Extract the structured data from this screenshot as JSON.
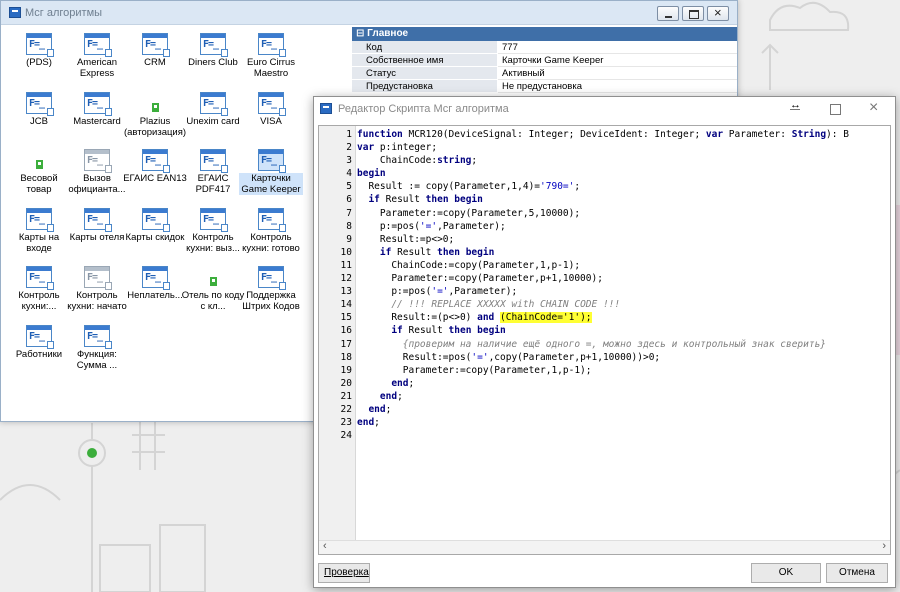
{
  "back_window": {
    "title": "Мсг алгоритмы",
    "icons": [
      {
        "label": "(PDS)",
        "kind": "doc"
      },
      {
        "label": "American Express",
        "kind": "doc"
      },
      {
        "label": "CRM",
        "kind": "doc"
      },
      {
        "label": "Diners Club",
        "kind": "doc"
      },
      {
        "label": "Euro Cirrus Maestro",
        "kind": "doc"
      },
      {
        "label": "JCB",
        "kind": "doc"
      },
      {
        "label": "Mastercard",
        "kind": "doc"
      },
      {
        "label": "Plazius (авторизация)",
        "kind": "green"
      },
      {
        "label": "Unexim card",
        "kind": "doc"
      },
      {
        "label": "VISA",
        "kind": "doc"
      },
      {
        "label": "Весовой товар",
        "kind": "green"
      },
      {
        "label": "Вызов официанта...",
        "kind": "doc-gray"
      },
      {
        "label": "ЕГАИС EAN13",
        "kind": "doc"
      },
      {
        "label": "ЕГАИС PDF417",
        "kind": "doc"
      },
      {
        "label": "Карточки Game Keeper",
        "kind": "doc-selected"
      },
      {
        "label": "Карты на входе",
        "kind": "doc"
      },
      {
        "label": "Карты отеля",
        "kind": "doc"
      },
      {
        "label": "Карты скидок",
        "kind": "doc"
      },
      {
        "label": "Контроль кухни: выз...",
        "kind": "doc"
      },
      {
        "label": "Контроль кухни: готово",
        "kind": "doc"
      },
      {
        "label": "Контроль кухни:...",
        "kind": "doc"
      },
      {
        "label": "Контроль кухни: начато",
        "kind": "doc-gray"
      },
      {
        "label": "Неплатель...",
        "kind": "doc"
      },
      {
        "label": "Отель по коду с кл...",
        "kind": "green"
      },
      {
        "label": "Поддержка Штрих Кодов",
        "kind": "doc"
      },
      {
        "label": "Работники",
        "kind": "doc"
      },
      {
        "label": "Функция: Сумма ...",
        "kind": "doc"
      }
    ],
    "properties": {
      "section": "Главное",
      "rows": [
        {
          "key": "Код",
          "value": "777"
        },
        {
          "key": "Собственное имя",
          "value": "Карточки Game Keeper"
        },
        {
          "key": "Статус",
          "value": "Активный"
        },
        {
          "key": "Предустановка",
          "value": "Не предустановка"
        }
      ]
    }
  },
  "editor_window": {
    "title": "Редактор Скрипта Мсг алгоритма",
    "resize_glyph": "↔",
    "buttons": {
      "check": "Проверка",
      "ok": "OK",
      "cancel": "Отмена"
    },
    "code_lines": [
      [
        {
          "t": "function",
          "c": "kw"
        },
        {
          "t": " MCR120(DeviceSignal: Integer; DeviceIdent: Integer; "
        },
        {
          "t": "var",
          "c": "kw"
        },
        {
          "t": " Parameter: "
        },
        {
          "t": "String",
          "c": "kw"
        },
        {
          "t": "): B"
        }
      ],
      [
        {
          "t": "var",
          "c": "kw"
        },
        {
          "t": " p:integer;"
        }
      ],
      [
        {
          "t": "    ChainCode:"
        },
        {
          "t": "string",
          "c": "kw"
        },
        {
          "t": ";"
        }
      ],
      [
        {
          "t": "begin",
          "c": "kw"
        }
      ],
      [
        {
          "t": "  Result := copy(Parameter,1,4)="
        },
        {
          "t": "'790='",
          "c": "str"
        },
        {
          "t": ";"
        }
      ],
      [
        {
          "t": "  "
        },
        {
          "t": "if",
          "c": "kw"
        },
        {
          "t": " Result "
        },
        {
          "t": "then begin",
          "c": "kw"
        }
      ],
      [
        {
          "t": "    Parameter:=copy(Parameter,5,10000);"
        }
      ],
      [
        {
          "t": "    p:=pos("
        },
        {
          "t": "'='",
          "c": "str"
        },
        {
          "t": ",Parameter);"
        }
      ],
      [
        {
          "t": "    Result:=p<>0;"
        }
      ],
      [
        {
          "t": "    "
        },
        {
          "t": "if",
          "c": "kw"
        },
        {
          "t": " Result "
        },
        {
          "t": "then begin",
          "c": "kw"
        }
      ],
      [
        {
          "t": "      ChainCode:=copy(Parameter,1,p-1);"
        }
      ],
      [
        {
          "t": "      Parameter:=copy(Parameter,p+1,10000);"
        }
      ],
      [
        {
          "t": "      p:=pos("
        },
        {
          "t": "'='",
          "c": "str"
        },
        {
          "t": ",Parameter);"
        }
      ],
      [
        {
          "t": "      "
        },
        {
          "t": "// !!! REPLACE XXXXX with CHAIN CODE !!!",
          "c": "cmt"
        }
      ],
      [
        {
          "t": "      Result:=(p<>0) "
        },
        {
          "t": "and",
          "c": "kw"
        },
        {
          "t": " "
        },
        {
          "t": "(ChainCode='1');",
          "c": "hl"
        }
      ],
      [
        {
          "t": "      "
        },
        {
          "t": "if",
          "c": "kw"
        },
        {
          "t": " Result "
        },
        {
          "t": "then begin",
          "c": "kw"
        }
      ],
      [
        {
          "t": "        "
        },
        {
          "t": "{проверим на наличие ещё одного =, можно здесь и контрольный знак сверить}",
          "c": "cmt"
        }
      ],
      [
        {
          "t": "        Result:=pos("
        },
        {
          "t": "'='",
          "c": "str"
        },
        {
          "t": ",copy(Parameter,p+1,10000))>0;"
        }
      ],
      [
        {
          "t": "        Parameter:=copy(Parameter,1,p-1);"
        }
      ],
      [
        {
          "t": "      "
        },
        {
          "t": "end",
          "c": "kw"
        },
        {
          "t": ";"
        }
      ],
      [
        {
          "t": "    "
        },
        {
          "t": "end",
          "c": "kw"
        },
        {
          "t": ";"
        }
      ],
      [
        {
          "t": "  "
        },
        {
          "t": "end",
          "c": "kw"
        },
        {
          "t": ";"
        }
      ],
      [
        {
          "t": "end",
          "c": "kw"
        },
        {
          "t": ";"
        }
      ],
      []
    ]
  }
}
